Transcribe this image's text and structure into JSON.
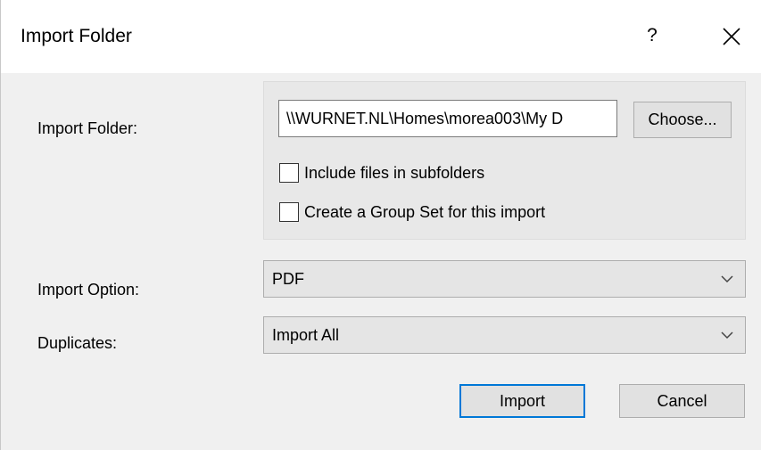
{
  "window": {
    "title": "Import Folder",
    "help_label": "?"
  },
  "import_folder": {
    "label": "Import Folder:",
    "path_value": "\\\\WURNET.NL\\Homes\\morea003\\My D",
    "choose_label": "Choose..."
  },
  "options": {
    "include_subfolders": {
      "label": "Include files in subfolders",
      "checked": false
    },
    "create_group_set": {
      "label": "Create a Group Set for this import",
      "checked": false
    }
  },
  "import_option": {
    "label": "Import Option:",
    "selected": "PDF"
  },
  "duplicates": {
    "label": "Duplicates:",
    "selected": "Import All"
  },
  "actions": {
    "import_label": "Import",
    "cancel_label": "Cancel"
  },
  "colors": {
    "default_button_border": "#0078d7",
    "dialog_background": "#f0f0f0",
    "titlebar_background": "#ffffff"
  },
  "icons": {
    "close": "close-icon",
    "combo_arrow": "chevron-down-icon"
  }
}
